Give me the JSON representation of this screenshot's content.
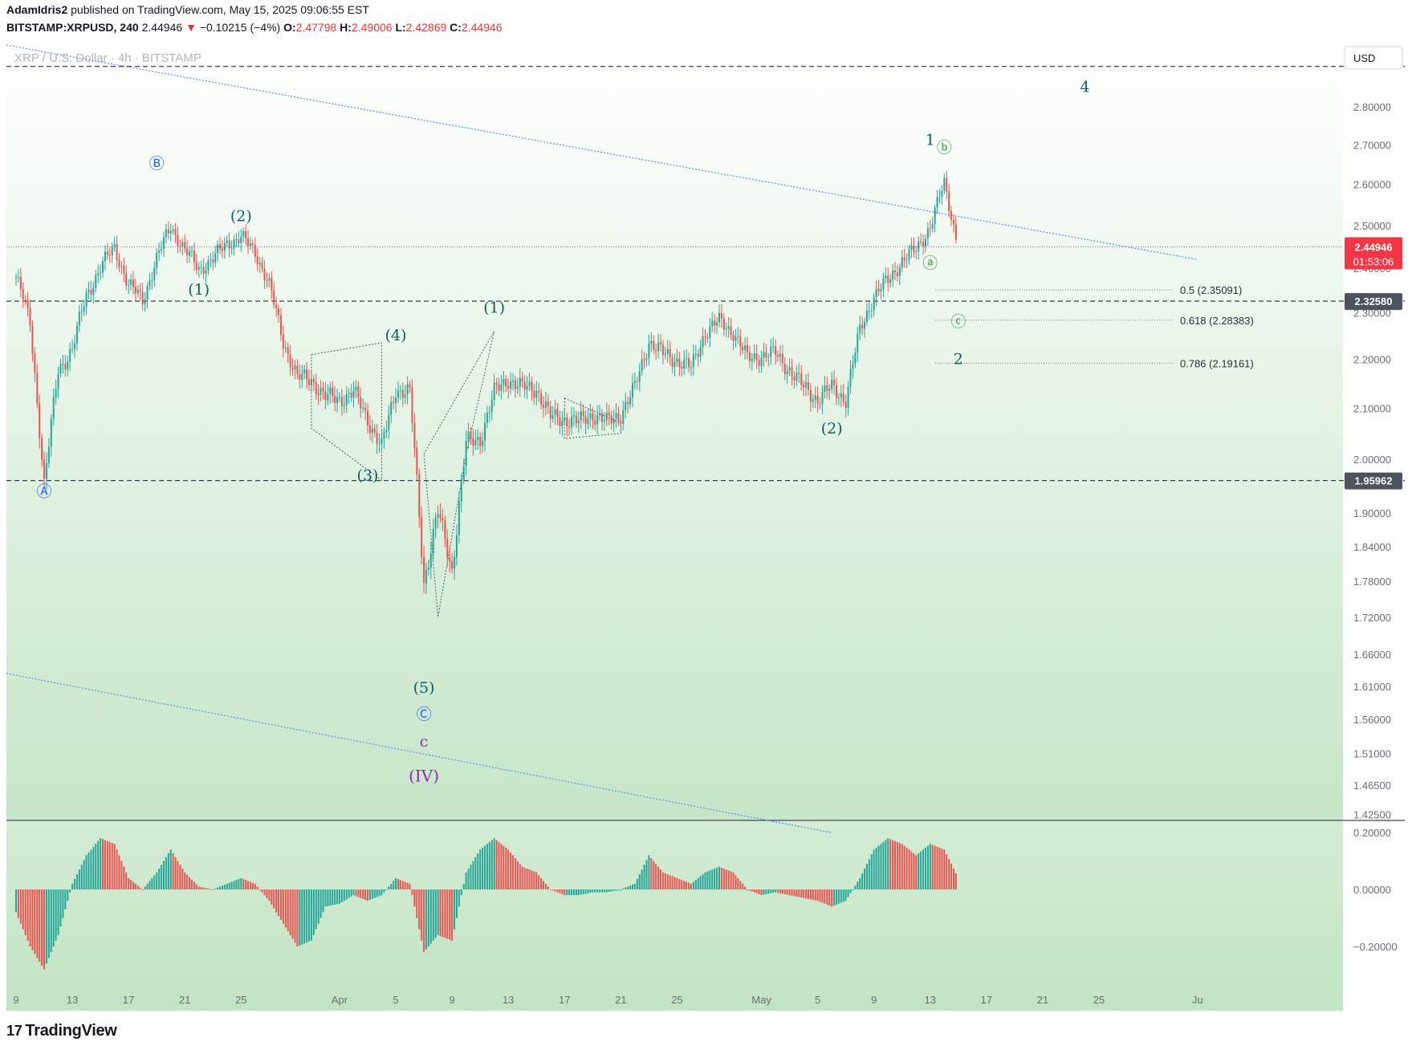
{
  "header": {
    "author": "AdamIdris2",
    "published_text": "published on TradingView.com, May 15, 2025 09:06:55 EST",
    "symbol": "BITSTAMP:XRPUSD, 240",
    "last": "2.44946",
    "change_arrow": "▼",
    "change": "−0.10215 (−4%)",
    "o_label": "O:",
    "o": "2.47798",
    "h_label": "H:",
    "h": "2.49006",
    "l_label": "L:",
    "l": "2.42869",
    "c_label": "C:",
    "c": "2.44946"
  },
  "watermark": "XRP / U.S. Dollar · 4h · BITSTAMP",
  "currency": "USD",
  "footer": {
    "logo_mark": "17",
    "logo_text": "TradingView"
  },
  "colors": {
    "up": "#26a69a",
    "down": "#ef5350",
    "wave_teal": "#0f5f5a",
    "wave_blue": "#2962ff",
    "wave_purple": "#9c27b0",
    "wave_green": "#43a047",
    "trendline": "#5b8def"
  },
  "chart_data": [
    {
      "type": "line",
      "title": "",
      "ylim": [
        1.4,
        2.9
      ],
      "y_scale": "log",
      "y_ticks": [
        "2.80000",
        "2.70000",
        "2.60000",
        "2.50000",
        "2.40000",
        "2.30000",
        "2.20000",
        "2.10000",
        "2.00000",
        "1.90000",
        "1.84000",
        "1.78000",
        "1.72000",
        "1.66000",
        "1.61000",
        "1.56000",
        "1.51000",
        "1.46500",
        "1.42500"
      ],
      "x_ticks": [
        "9",
        "13",
        "17",
        "21",
        "25",
        "Apr",
        "5",
        "9",
        "13",
        "17",
        "21",
        "25",
        "May",
        "5",
        "9",
        "13",
        "17",
        "21",
        "25",
        "Ju"
      ],
      "x_tick_dates": [
        "2025-03-09",
        "2025-03-13",
        "2025-03-17",
        "2025-03-21",
        "2025-03-25",
        "2025-04-01",
        "2025-04-05",
        "2025-04-09",
        "2025-04-13",
        "2025-04-17",
        "2025-04-21",
        "2025-04-25",
        "2025-05-01",
        "2025-05-05",
        "2025-05-09",
        "2025-05-13",
        "2025-05-17",
        "2025-05-21",
        "2025-05-25",
        "2025-06-01"
      ],
      "price_series": {
        "name": "",
        "points": [
          [
            "2025-03-09",
            2.38
          ],
          [
            "2025-03-10",
            2.28
          ],
          [
            "2025-03-11",
            1.95
          ],
          [
            "2025-03-12",
            2.18
          ],
          [
            "2025-03-13",
            2.22
          ],
          [
            "2025-03-14",
            2.34
          ],
          [
            "2025-03-15",
            2.4
          ],
          [
            "2025-03-16",
            2.45
          ],
          [
            "2025-03-17",
            2.36
          ],
          [
            "2025-03-18",
            2.33
          ],
          [
            "2025-03-19",
            2.42
          ],
          [
            "2025-03-20",
            2.5
          ],
          [
            "2025-03-21",
            2.44
          ],
          [
            "2025-03-22",
            2.4
          ],
          [
            "2025-03-23",
            2.42
          ],
          [
            "2025-03-24",
            2.46
          ],
          [
            "2025-03-25",
            2.47
          ],
          [
            "2025-03-26",
            2.44
          ],
          [
            "2025-03-27",
            2.36
          ],
          [
            "2025-03-28",
            2.24
          ],
          [
            "2025-03-29",
            2.16
          ],
          [
            "2025-03-30",
            2.16
          ],
          [
            "2025-03-31",
            2.12
          ],
          [
            "2025-04-01",
            2.12
          ],
          [
            "2025-04-02",
            2.13
          ],
          [
            "2025-04-03",
            2.08
          ],
          [
            "2025-04-04",
            2.02
          ],
          [
            "2025-04-05",
            2.14
          ],
          [
            "2025-04-06",
            2.13
          ],
          [
            "2025-04-07",
            1.78
          ],
          [
            "2025-04-08",
            1.9
          ],
          [
            "2025-04-09",
            1.8
          ],
          [
            "2025-04-10",
            2.03
          ],
          [
            "2025-04-11",
            2.04
          ],
          [
            "2025-04-12",
            2.13
          ],
          [
            "2025-04-13",
            2.16
          ],
          [
            "2025-04-14",
            2.14
          ],
          [
            "2025-04-15",
            2.14
          ],
          [
            "2025-04-16",
            2.08
          ],
          [
            "2025-04-17",
            2.08
          ],
          [
            "2025-04-18",
            2.07
          ],
          [
            "2025-04-19",
            2.09
          ],
          [
            "2025-04-20",
            2.07
          ],
          [
            "2025-04-21",
            2.09
          ],
          [
            "2025-04-22",
            2.14
          ],
          [
            "2025-04-23",
            2.24
          ],
          [
            "2025-04-24",
            2.21
          ],
          [
            "2025-04-25",
            2.2
          ],
          [
            "2025-04-26",
            2.18
          ],
          [
            "2025-04-27",
            2.26
          ],
          [
            "2025-04-28",
            2.28
          ],
          [
            "2025-04-29",
            2.26
          ],
          [
            "2025-04-30",
            2.2
          ],
          [
            "2025-05-01",
            2.21
          ],
          [
            "2025-05-02",
            2.21
          ],
          [
            "2025-05-03",
            2.18
          ],
          [
            "2025-05-04",
            2.14
          ],
          [
            "2025-05-05",
            2.12
          ],
          [
            "2025-05-06",
            2.14
          ],
          [
            "2025-05-07",
            2.12
          ],
          [
            "2025-05-08",
            2.26
          ],
          [
            "2025-05-09",
            2.34
          ],
          [
            "2025-05-10",
            2.37
          ],
          [
            "2025-05-11",
            2.42
          ],
          [
            "2025-05-12",
            2.44
          ],
          [
            "2025-05-13",
            2.5
          ],
          [
            "2025-05-14",
            2.6
          ],
          [
            "2025-05-15",
            2.45
          ]
        ]
      },
      "price_lines": [
        {
          "label": "2.44946",
          "value": 2.44946,
          "style": "dotted-red",
          "countdown": "01:53:06"
        },
        {
          "label": "2.32580",
          "value": 2.3258,
          "style": "dashed"
        },
        {
          "label": "1.95962",
          "value": 1.95962,
          "style": "dashed"
        },
        {
          "label": "",
          "value": 2.91,
          "style": "dashed"
        }
      ],
      "fib_levels": [
        {
          "label": "0.5 (2.35091)",
          "value": 2.35091
        },
        {
          "label": "0.618 (2.28383)",
          "value": 2.28383
        },
        {
          "label": "0.786 (2.19161)",
          "value": 2.19161
        }
      ],
      "trendlines": [
        {
          "from": [
            "2025-03-05",
            2.97
          ],
          "to": [
            "2025-06-01",
            2.42
          ]
        },
        {
          "from": [
            "2025-03-05",
            1.63
          ],
          "to": [
            "2025-05-06",
            1.4
          ]
        }
      ],
      "annotations": [
        {
          "text": "Ⓐ",
          "date": "2025-03-11",
          "price": 1.93,
          "color": "blue"
        },
        {
          "text": "Ⓑ",
          "date": "2025-03-19",
          "price": 2.64,
          "color": "blue"
        },
        {
          "text": "(1)",
          "date": "2025-03-22",
          "price": 2.34,
          "color": "teal"
        },
        {
          "text": "(2)",
          "date": "2025-03-25",
          "price": 2.51,
          "color": "teal"
        },
        {
          "text": "(3)",
          "date": "2025-04-03",
          "price": 1.96,
          "color": "teal"
        },
        {
          "text": "(4)",
          "date": "2025-04-05",
          "price": 2.24,
          "color": "teal"
        },
        {
          "text": "(5)",
          "date": "2025-04-07",
          "price": 1.6,
          "color": "teal"
        },
        {
          "text": "Ⓒ",
          "date": "2025-04-07",
          "price": 1.56,
          "color": "blue"
        },
        {
          "text": "c",
          "date": "2025-04-07",
          "price": 1.52,
          "color": "purple"
        },
        {
          "text": "(IV)",
          "date": "2025-04-07",
          "price": 1.47,
          "color": "purple"
        },
        {
          "text": "(1)",
          "date": "2025-04-12",
          "price": 2.3,
          "color": "teal"
        },
        {
          "text": "(2)",
          "date": "2025-05-06",
          "price": 2.05,
          "color": "teal"
        },
        {
          "text": "1",
          "date": "2025-05-13",
          "price": 2.7,
          "color": "teal"
        },
        {
          "text": "ⓑ",
          "date": "2025-05-14",
          "price": 2.68,
          "color": "green"
        },
        {
          "text": "ⓐ",
          "date": "2025-05-13",
          "price": 2.4,
          "color": "green"
        },
        {
          "text": "ⓒ",
          "date": "2025-05-15",
          "price": 2.27,
          "color": "green"
        },
        {
          "text": "2",
          "date": "2025-05-15",
          "price": 2.19,
          "color": "teal"
        },
        {
          "text": "4",
          "date": "2025-05-24",
          "price": 2.84,
          "color": "teal"
        }
      ]
    },
    {
      "type": "bar",
      "title": "",
      "ylim": [
        -0.3,
        0.22
      ],
      "y_ticks": [
        "0.20000",
        "0.00000",
        "−0.20000"
      ],
      "series": [
        {
          "name": "",
          "points": [
            [
              "2025-03-09",
              -0.08
            ],
            [
              "2025-03-10",
              -0.2
            ],
            [
              "2025-03-11",
              -0.28
            ],
            [
              "2025-03-12",
              -0.16
            ],
            [
              "2025-03-13",
              0.02
            ],
            [
              "2025-03-14",
              0.12
            ],
            [
              "2025-03-15",
              0.18
            ],
            [
              "2025-03-16",
              0.16
            ],
            [
              "2025-03-17",
              0.04
            ],
            [
              "2025-03-18",
              0.0
            ],
            [
              "2025-03-19",
              0.06
            ],
            [
              "2025-03-20",
              0.14
            ],
            [
              "2025-03-21",
              0.06
            ],
            [
              "2025-03-22",
              0.01
            ],
            [
              "2025-03-23",
              0.0
            ],
            [
              "2025-03-24",
              0.02
            ],
            [
              "2025-03-25",
              0.04
            ],
            [
              "2025-03-26",
              0.02
            ],
            [
              "2025-03-27",
              -0.04
            ],
            [
              "2025-03-28",
              -0.12
            ],
            [
              "2025-03-29",
              -0.2
            ],
            [
              "2025-03-30",
              -0.18
            ],
            [
              "2025-03-31",
              -0.06
            ],
            [
              "2025-04-01",
              -0.05
            ],
            [
              "2025-04-02",
              -0.02
            ],
            [
              "2025-04-03",
              -0.04
            ],
            [
              "2025-04-04",
              -0.02
            ],
            [
              "2025-04-05",
              0.04
            ],
            [
              "2025-04-06",
              0.02
            ],
            [
              "2025-04-07",
              -0.22
            ],
            [
              "2025-04-08",
              -0.16
            ],
            [
              "2025-04-09",
              -0.18
            ],
            [
              "2025-04-10",
              0.06
            ],
            [
              "2025-04-11",
              0.14
            ],
            [
              "2025-04-12",
              0.18
            ],
            [
              "2025-04-13",
              0.14
            ],
            [
              "2025-04-14",
              0.08
            ],
            [
              "2025-04-15",
              0.06
            ],
            [
              "2025-04-16",
              0.0
            ],
            [
              "2025-04-17",
              -0.02
            ],
            [
              "2025-04-18",
              -0.02
            ],
            [
              "2025-04-19",
              -0.01
            ],
            [
              "2025-04-20",
              -0.01
            ],
            [
              "2025-04-21",
              0.0
            ],
            [
              "2025-04-22",
              0.02
            ],
            [
              "2025-04-23",
              0.12
            ],
            [
              "2025-04-24",
              0.06
            ],
            [
              "2025-04-25",
              0.04
            ],
            [
              "2025-04-26",
              0.02
            ],
            [
              "2025-04-27",
              0.06
            ],
            [
              "2025-04-28",
              0.08
            ],
            [
              "2025-04-29",
              0.06
            ],
            [
              "2025-04-30",
              0.0
            ],
            [
              "2025-05-01",
              -0.02
            ],
            [
              "2025-05-02",
              -0.01
            ],
            [
              "2025-05-03",
              -0.02
            ],
            [
              "2025-05-04",
              -0.03
            ],
            [
              "2025-05-05",
              -0.04
            ],
            [
              "2025-05-06",
              -0.06
            ],
            [
              "2025-05-07",
              -0.04
            ],
            [
              "2025-05-08",
              0.04
            ],
            [
              "2025-05-09",
              0.14
            ],
            [
              "2025-05-10",
              0.18
            ],
            [
              "2025-05-11",
              0.16
            ],
            [
              "2025-05-12",
              0.12
            ],
            [
              "2025-05-13",
              0.16
            ],
            [
              "2025-05-14",
              0.14
            ],
            [
              "2025-05-15",
              0.04
            ]
          ]
        }
      ]
    }
  ]
}
